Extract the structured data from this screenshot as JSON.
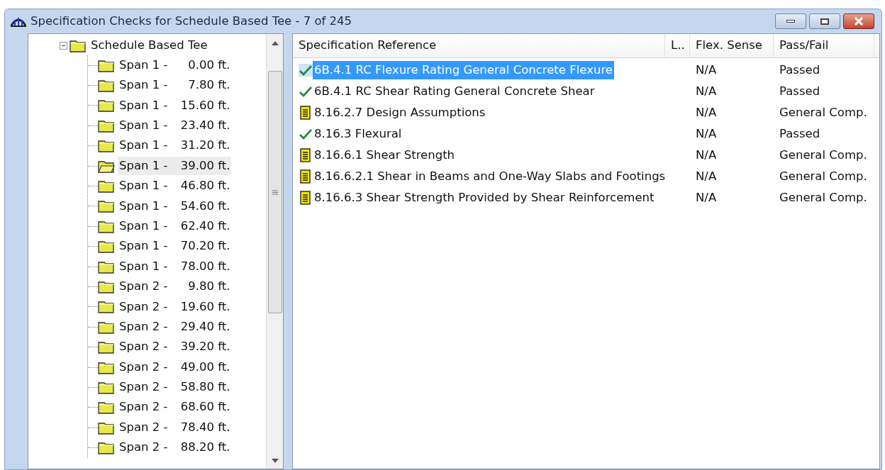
{
  "window": {
    "title": "Specification Checks for Schedule Based Tee - 7 of 245"
  },
  "tree": {
    "label": "Schedule Based Tee",
    "expanded": true,
    "children": [
      {
        "label": "Span 1 -",
        "station": "0.00 ft.",
        "selected": false
      },
      {
        "label": "Span 1 -",
        "station": "7.80 ft.",
        "selected": false
      },
      {
        "label": "Span 1 -",
        "station": "15.60 ft.",
        "selected": false
      },
      {
        "label": "Span 1 -",
        "station": "23.40 ft.",
        "selected": false
      },
      {
        "label": "Span 1 -",
        "station": "31.20 ft.",
        "selected": false
      },
      {
        "label": "Span 1 -",
        "station": "39.00 ft.",
        "selected": true
      },
      {
        "label": "Span 1 -",
        "station": "46.80 ft.",
        "selected": false
      },
      {
        "label": "Span 1 -",
        "station": "54.60 ft.",
        "selected": false
      },
      {
        "label": "Span 1 -",
        "station": "62.40 ft.",
        "selected": false
      },
      {
        "label": "Span 1 -",
        "station": "70.20 ft.",
        "selected": false
      },
      {
        "label": "Span 1 -",
        "station": "78.00 ft.",
        "selected": false
      },
      {
        "label": "Span 2 -",
        "station": "9.80 ft.",
        "selected": false
      },
      {
        "label": "Span 2 -",
        "station": "19.60 ft.",
        "selected": false
      },
      {
        "label": "Span 2 -",
        "station": "29.40 ft.",
        "selected": false
      },
      {
        "label": "Span 2 -",
        "station": "39.20 ft.",
        "selected": false
      },
      {
        "label": "Span 2 -",
        "station": "49.00 ft.",
        "selected": false
      },
      {
        "label": "Span 2 -",
        "station": "58.80 ft.",
        "selected": false
      },
      {
        "label": "Span 2 -",
        "station": "68.60 ft.",
        "selected": false
      },
      {
        "label": "Span 2 -",
        "station": "78.40 ft.",
        "selected": false
      },
      {
        "label": "Span 2 -",
        "station": "88.20 ft.",
        "selected": false
      }
    ]
  },
  "table": {
    "columns": [
      "Specification Reference",
      "L..",
      "Flex. Sense",
      "Pass/Fail"
    ],
    "rows": [
      {
        "kind": "check",
        "reference": "6B.4.1 RC Flexure Rating General Concrete Flexure",
        "flex_sense": "N/A",
        "pass_fail": "Passed",
        "selected": true
      },
      {
        "kind": "check",
        "reference": "6B.4.1 RC Shear Rating General Concrete Shear",
        "flex_sense": "N/A",
        "pass_fail": "Passed",
        "selected": false
      },
      {
        "kind": "doc",
        "reference": "8.16.2.7 Design Assumptions",
        "flex_sense": "N/A",
        "pass_fail": "General Comp.",
        "selected": false
      },
      {
        "kind": "check",
        "reference": "8.16.3 Flexural",
        "flex_sense": "N/A",
        "pass_fail": "Passed",
        "selected": false
      },
      {
        "kind": "doc",
        "reference": "8.16.6.1 Shear Strength",
        "flex_sense": "N/A",
        "pass_fail": "General Comp.",
        "selected": false
      },
      {
        "kind": "doc",
        "reference": "8.16.6.2.1 Shear in Beams and One-Way Slabs and Footings",
        "flex_sense": "N/A",
        "pass_fail": "General Comp.",
        "selected": false
      },
      {
        "kind": "doc",
        "reference": "8.16.6.3 Shear Strength Provided by Shear Reinforcement",
        "flex_sense": "N/A",
        "pass_fail": "General Comp.",
        "selected": false
      }
    ]
  }
}
